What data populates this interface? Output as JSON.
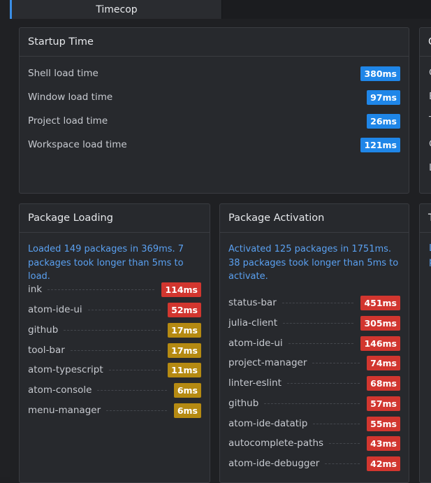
{
  "tab": {
    "title": "Timecop"
  },
  "startup": {
    "title": "Startup Time",
    "rows": [
      {
        "label": "Shell load time",
        "value": "380ms"
      },
      {
        "label": "Window load time",
        "value": "97ms"
      },
      {
        "label": "Project load time",
        "value": "26ms"
      },
      {
        "label": "Workspace load time",
        "value": "121ms"
      }
    ]
  },
  "loading": {
    "title": "Package Loading",
    "summary": "Loaded 149 packages in 369ms. 7 packages took longer than 5ms to load.",
    "items": [
      {
        "name": "ink",
        "value": "114ms",
        "severity": "red"
      },
      {
        "name": "atom-ide-ui",
        "value": "52ms",
        "severity": "red"
      },
      {
        "name": "github",
        "value": "17ms",
        "severity": "amber"
      },
      {
        "name": "tool-bar",
        "value": "17ms",
        "severity": "amber"
      },
      {
        "name": "atom-typescript",
        "value": "11ms",
        "severity": "amber"
      },
      {
        "name": "atom-console",
        "value": "6ms",
        "severity": "amber"
      },
      {
        "name": "menu-manager",
        "value": "6ms",
        "severity": "amber"
      }
    ]
  },
  "activation": {
    "title": "Package Activation",
    "summary": "Activated 125 packages in 1751ms. 38 packages took longer than 5ms to activate.",
    "items": [
      {
        "name": "status-bar",
        "value": "451ms",
        "severity": "red"
      },
      {
        "name": "julia-client",
        "value": "305ms",
        "severity": "red"
      },
      {
        "name": "atom-ide-ui",
        "value": "146ms",
        "severity": "red"
      },
      {
        "name": "project-manager",
        "value": "74ms",
        "severity": "red"
      },
      {
        "name": "linter-eslint",
        "value": "68ms",
        "severity": "red"
      },
      {
        "name": "github",
        "value": "57ms",
        "severity": "red"
      },
      {
        "name": "atom-ide-datatip",
        "value": "55ms",
        "severity": "red"
      },
      {
        "name": "autocomplete-paths",
        "value": "43ms",
        "severity": "red"
      },
      {
        "name": "atom-ide-debugger",
        "value": "42ms",
        "severity": "red"
      }
    ]
  },
  "cutoff": {
    "top_header": "C",
    "top_letters": [
      "C",
      "E",
      "T",
      "C",
      "L"
    ],
    "bottom_header": "T",
    "bottom_letters": [
      "L",
      "p"
    ]
  },
  "colors": {
    "blue": "#1f86e8",
    "red": "#d2362f",
    "amber": "#b58a12",
    "link": "#5aa0f0"
  }
}
